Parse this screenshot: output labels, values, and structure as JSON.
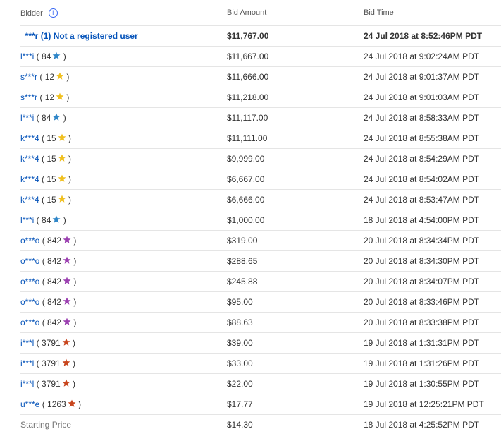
{
  "header": {
    "bidder": "Bidder",
    "info_icon_glyph": "i",
    "amount": "Bid Amount",
    "time": "Bid Time"
  },
  "top_row": {
    "bidder": "_***r (1) Not a registered user",
    "amount": "$11,767.00",
    "time": "24 Jul 2018 at 8:52:46PM PDT"
  },
  "star_colors": {
    "blue": "#2f86c8",
    "yellow": "#f0c020",
    "purple": "#9b3fb0",
    "red": "#c8461e"
  },
  "rows": [
    {
      "name": "l***i",
      "open": " ( ",
      "score": "84",
      "star": "blue",
      "close": " )",
      "amount": "$11,667.00",
      "time": "24 Jul 2018 at 9:02:24AM PDT"
    },
    {
      "name": "s***r",
      "open": " ( ",
      "score": "12",
      "star": "yellow",
      "close": " )",
      "amount": "$11,666.00",
      "time": "24 Jul 2018 at 9:01:37AM PDT"
    },
    {
      "name": "s***r",
      "open": " ( ",
      "score": "12",
      "star": "yellow",
      "close": " )",
      "amount": "$11,218.00",
      "time": "24 Jul 2018 at 9:01:03AM PDT"
    },
    {
      "name": "l***i",
      "open": " ( ",
      "score": "84",
      "star": "blue",
      "close": " )",
      "amount": "$11,117.00",
      "time": "24 Jul 2018 at 8:58:33AM PDT"
    },
    {
      "name": "k***4",
      "open": " ( ",
      "score": "15",
      "star": "yellow",
      "close": " )",
      "amount": "$11,111.00",
      "time": "24 Jul 2018 at 8:55:38AM PDT"
    },
    {
      "name": "k***4",
      "open": " ( ",
      "score": "15",
      "star": "yellow",
      "close": " )",
      "amount": "$9,999.00",
      "time": "24 Jul 2018 at 8:54:29AM PDT"
    },
    {
      "name": "k***4",
      "open": " ( ",
      "score": "15",
      "star": "yellow",
      "close": " )",
      "amount": "$6,667.00",
      "time": "24 Jul 2018 at 8:54:02AM PDT"
    },
    {
      "name": "k***4",
      "open": " ( ",
      "score": "15",
      "star": "yellow",
      "close": " )",
      "amount": "$6,666.00",
      "time": "24 Jul 2018 at 8:53:47AM PDT"
    },
    {
      "name": "l***i",
      "open": " ( ",
      "score": "84",
      "star": "blue",
      "close": " )",
      "amount": "$1,000.00",
      "time": "18 Jul 2018 at 4:54:00PM PDT"
    },
    {
      "name": "o***o",
      "open": " ( ",
      "score": "842",
      "star": "purple",
      "close": " )",
      "amount": "$319.00",
      "time": "20 Jul 2018 at 8:34:34PM PDT"
    },
    {
      "name": "o***o",
      "open": " ( ",
      "score": "842",
      "star": "purple",
      "close": " )",
      "amount": "$288.65",
      "time": "20 Jul 2018 at 8:34:30PM PDT"
    },
    {
      "name": "o***o",
      "open": " ( ",
      "score": "842",
      "star": "purple",
      "close": " )",
      "amount": "$245.88",
      "time": "20 Jul 2018 at 8:34:07PM PDT"
    },
    {
      "name": "o***o",
      "open": " ( ",
      "score": "842",
      "star": "purple",
      "close": " )",
      "amount": "$95.00",
      "time": "20 Jul 2018 at 8:33:46PM PDT"
    },
    {
      "name": "o***o",
      "open": " ( ",
      "score": "842",
      "star": "purple",
      "close": " )",
      "amount": "$88.63",
      "time": "20 Jul 2018 at 8:33:38PM PDT"
    },
    {
      "name": "i***l",
      "open": " ( ",
      "score": "3791",
      "star": "red",
      "close": " )",
      "amount": "$39.00",
      "time": "19 Jul 2018 at 1:31:31PM PDT"
    },
    {
      "name": "i***l",
      "open": " ( ",
      "score": "3791",
      "star": "red",
      "close": " )",
      "amount": "$33.00",
      "time": "19 Jul 2018 at 1:31:26PM PDT"
    },
    {
      "name": "i***l",
      "open": " ( ",
      "score": "3791",
      "star": "red",
      "close": " )",
      "amount": "$22.00",
      "time": "19 Jul 2018 at 1:30:55PM PDT"
    },
    {
      "name": "u***e",
      "open": " ( ",
      "score": "1263",
      "star": "red",
      "close": " )",
      "amount": "$17.77",
      "time": "19 Jul 2018 at 12:25:21PM PDT"
    }
  ],
  "starting_row": {
    "bidder": "Starting Price",
    "amount": "$14.30",
    "time": "18 Jul 2018 at 4:25:52PM PDT"
  }
}
